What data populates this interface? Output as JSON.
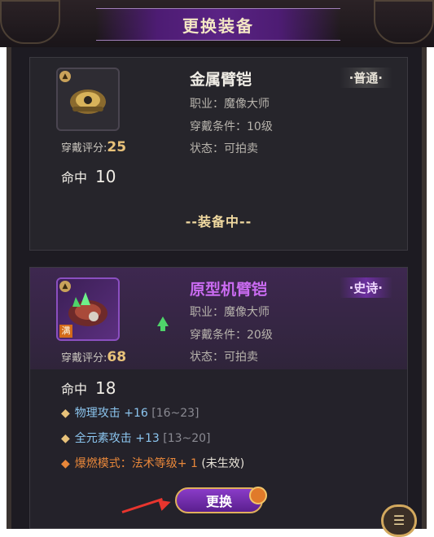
{
  "title": "更换装备",
  "score_label": "穿戴评分:",
  "equipped_label": "--装备中--",
  "current_item": {
    "name": "金属臂铠",
    "name_color": "#f0ede6",
    "rarity": "·普通·",
    "class_line": "职业：魔像大师",
    "req_line": "穿戴条件：10级",
    "status_line": "状态：可拍卖",
    "score": "25",
    "stat_label": "命中",
    "stat_value": "10"
  },
  "new_item": {
    "name": "原型机臂铠",
    "name_color": "#c96bf0",
    "rarity": "·史诗·",
    "class_line": "职业：魔像大师",
    "req_line": "穿戴条件：20级",
    "status_line": "状态：可拍卖",
    "score": "68",
    "full_badge": "满",
    "stat_label": "命中",
    "stat_value": "18",
    "attrs": [
      {
        "name": "物理攻击 +16",
        "range": "[16~23]"
      },
      {
        "name": "全元素攻击 +13",
        "range": "[13~20]"
      }
    ],
    "burn": {
      "name": "爆燃模式：法术等级+ 1",
      "tail": "(未生效)"
    }
  },
  "swap_button": "更换",
  "icons": {
    "slot": "armor-slot-icon",
    "upgrade": "up-arrow-icon",
    "chat": "chat-bubble-icon",
    "diamond": "◆"
  }
}
